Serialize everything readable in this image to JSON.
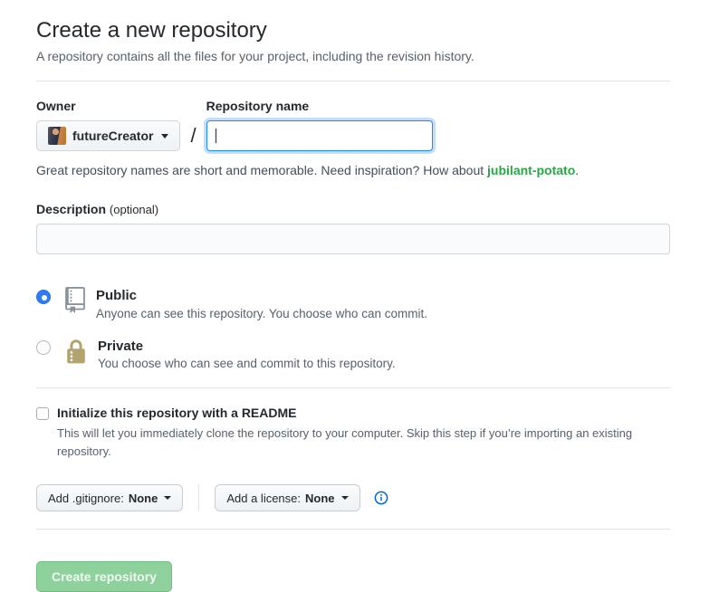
{
  "header": {
    "title": "Create a new repository",
    "subtitle": "A repository contains all the files for your project, including the revision history."
  },
  "form": {
    "owner": {
      "label": "Owner",
      "username": "futureCreator"
    },
    "separator": "/",
    "repo_name": {
      "label": "Repository name",
      "value": "",
      "focused": true
    },
    "hint": {
      "before": "Great repository names are short and memorable. Need inspiration? How about ",
      "suggestion": "jubilant-potato",
      "after": "."
    },
    "description": {
      "label": "Description",
      "optional_tag": "(optional)",
      "value": ""
    },
    "visibility": {
      "options": [
        {
          "label": "Public",
          "description": "Anyone can see this repository. You choose who can commit.",
          "icon": "repo-icon",
          "selected": true
        },
        {
          "label": "Private",
          "description": "You choose who can see and commit to this repository.",
          "icon": "lock-icon",
          "selected": false
        }
      ]
    },
    "readme": {
      "label": "Initialize this repository with a README",
      "description": "This will let you immediately clone the repository to your computer. Skip this step if you’re importing an existing repository.",
      "checked": false
    },
    "gitignore_button": {
      "prefix": "Add .gitignore:",
      "value": "None"
    },
    "license_button": {
      "prefix": "Add a license:",
      "value": "None"
    }
  },
  "actions": {
    "create_button": "Create repository",
    "create_enabled": false
  },
  "colors": {
    "suggestion_green": "#28a745",
    "focus_blue": "#2188ff",
    "disabled_button_green": "#8fd19d",
    "repo_icon_gray": "#8a939b",
    "lock_icon_tan": "#b3a46e",
    "info_blue": "#0366d6"
  }
}
